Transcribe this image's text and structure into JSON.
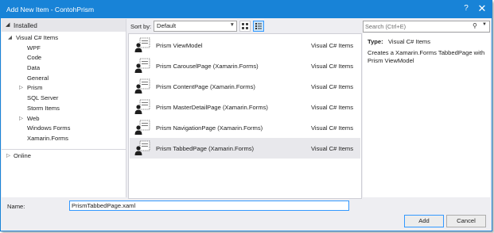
{
  "window": {
    "title": "Add New Item - ContohPrism",
    "help_glyph": "?",
    "close_glyph": "✕"
  },
  "left_pane": {
    "installed_label": "Installed",
    "tree": [
      {
        "label": "Visual C# Items",
        "expander": "◢",
        "level": 1
      },
      {
        "label": "WPF",
        "expander": "",
        "level": 2
      },
      {
        "label": "Code",
        "expander": "",
        "level": 2
      },
      {
        "label": "Data",
        "expander": "",
        "level": 2
      },
      {
        "label": "General",
        "expander": "",
        "level": 2
      },
      {
        "label": "Prism",
        "expander": "▷",
        "level": 2
      },
      {
        "label": "SQL Server",
        "expander": "",
        "level": 2
      },
      {
        "label": "Storm Items",
        "expander": "",
        "level": 2
      },
      {
        "label": "Web",
        "expander": "▷",
        "level": 2
      },
      {
        "label": "Windows Forms",
        "expander": "",
        "level": 2
      },
      {
        "label": "Xamarin.Forms",
        "expander": "",
        "level": 2
      }
    ],
    "online_label": "Online"
  },
  "toolbar": {
    "sort_label": "Sort by:",
    "sort_value": "Default"
  },
  "items": [
    {
      "name": "Prism ViewModel",
      "lang": "Visual C# Items",
      "selected": false
    },
    {
      "name": "Prism CarouselPage (Xamarin.Forms)",
      "lang": "Visual C# Items",
      "selected": false
    },
    {
      "name": "Prism ContentPage (Xamarin.Forms)",
      "lang": "Visual C# Items",
      "selected": false
    },
    {
      "name": "Prism MasterDetailPage (Xamarin.Forms)",
      "lang": "Visual C# Items",
      "selected": false
    },
    {
      "name": "Prism NavigationPage (Xamarin.Forms)",
      "lang": "Visual C# Items",
      "selected": false
    },
    {
      "name": "Prism TabbedPage (Xamarin.Forms)",
      "lang": "Visual C# Items",
      "selected": true
    }
  ],
  "search": {
    "placeholder": "Search (Ctrl+E)"
  },
  "details": {
    "type_label": "Type:",
    "type_value": "Visual C# Items",
    "description": "Creates a Xamarin.Forms TabbedPage with Prism ViewModel"
  },
  "name_field": {
    "label": "Name:",
    "value": "PrismTabbedPage.xaml"
  },
  "buttons": {
    "add": "Add",
    "cancel": "Cancel"
  },
  "colors": {
    "title_bar": "#1883d7",
    "selected_item": "#e8e8ec",
    "focus_border": "#3399ff"
  }
}
